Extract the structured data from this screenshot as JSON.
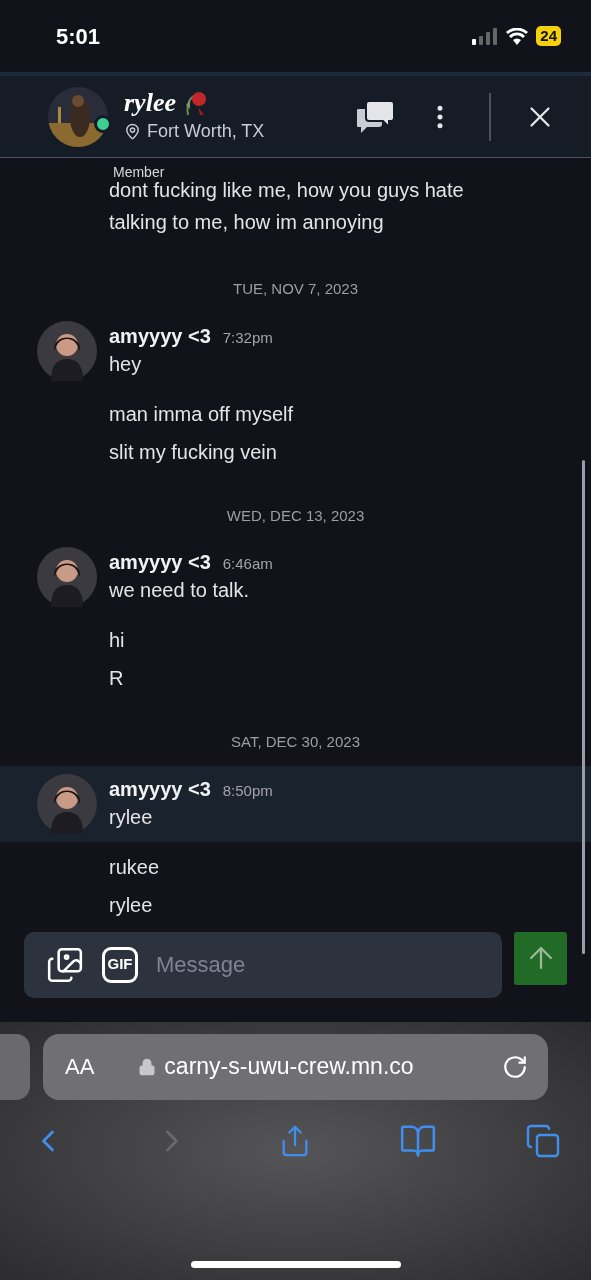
{
  "status_bar": {
    "time": "5:01",
    "battery": "24"
  },
  "header": {
    "name": "rylee",
    "location": "Fort Worth, TX",
    "role": "Member",
    "online": true
  },
  "feed": [
    {
      "kind": "partial",
      "text": "dont fucking like me, how you guys hate talking to me, how im annoying"
    },
    {
      "kind": "date",
      "text": "TUE, NOV 7, 2023"
    },
    {
      "kind": "group",
      "author": "amyyyy <3",
      "time": "7:32pm",
      "highlighted": false,
      "text": "hey",
      "followups": [
        "man imma off myself",
        "slit my fucking vein"
      ]
    },
    {
      "kind": "date",
      "text": "WED, DEC 13, 2023"
    },
    {
      "kind": "group",
      "author": "amyyyy <3",
      "time": "6:46am",
      "highlighted": false,
      "text": "we need to talk.",
      "followups": [
        "hi",
        "R"
      ]
    },
    {
      "kind": "date",
      "text": "SAT, DEC 30, 2023"
    },
    {
      "kind": "group",
      "author": "amyyyy <3",
      "time": "8:50pm",
      "highlighted": true,
      "text": "rylee",
      "followups": [
        "rukee",
        "rylee"
      ]
    }
  ],
  "composer": {
    "gif": "GIF",
    "placeholder": "Message"
  },
  "browser": {
    "text_size": "AA",
    "url": "carny-s-uwu-crew.mn.co",
    "forward_disabled": true
  }
}
